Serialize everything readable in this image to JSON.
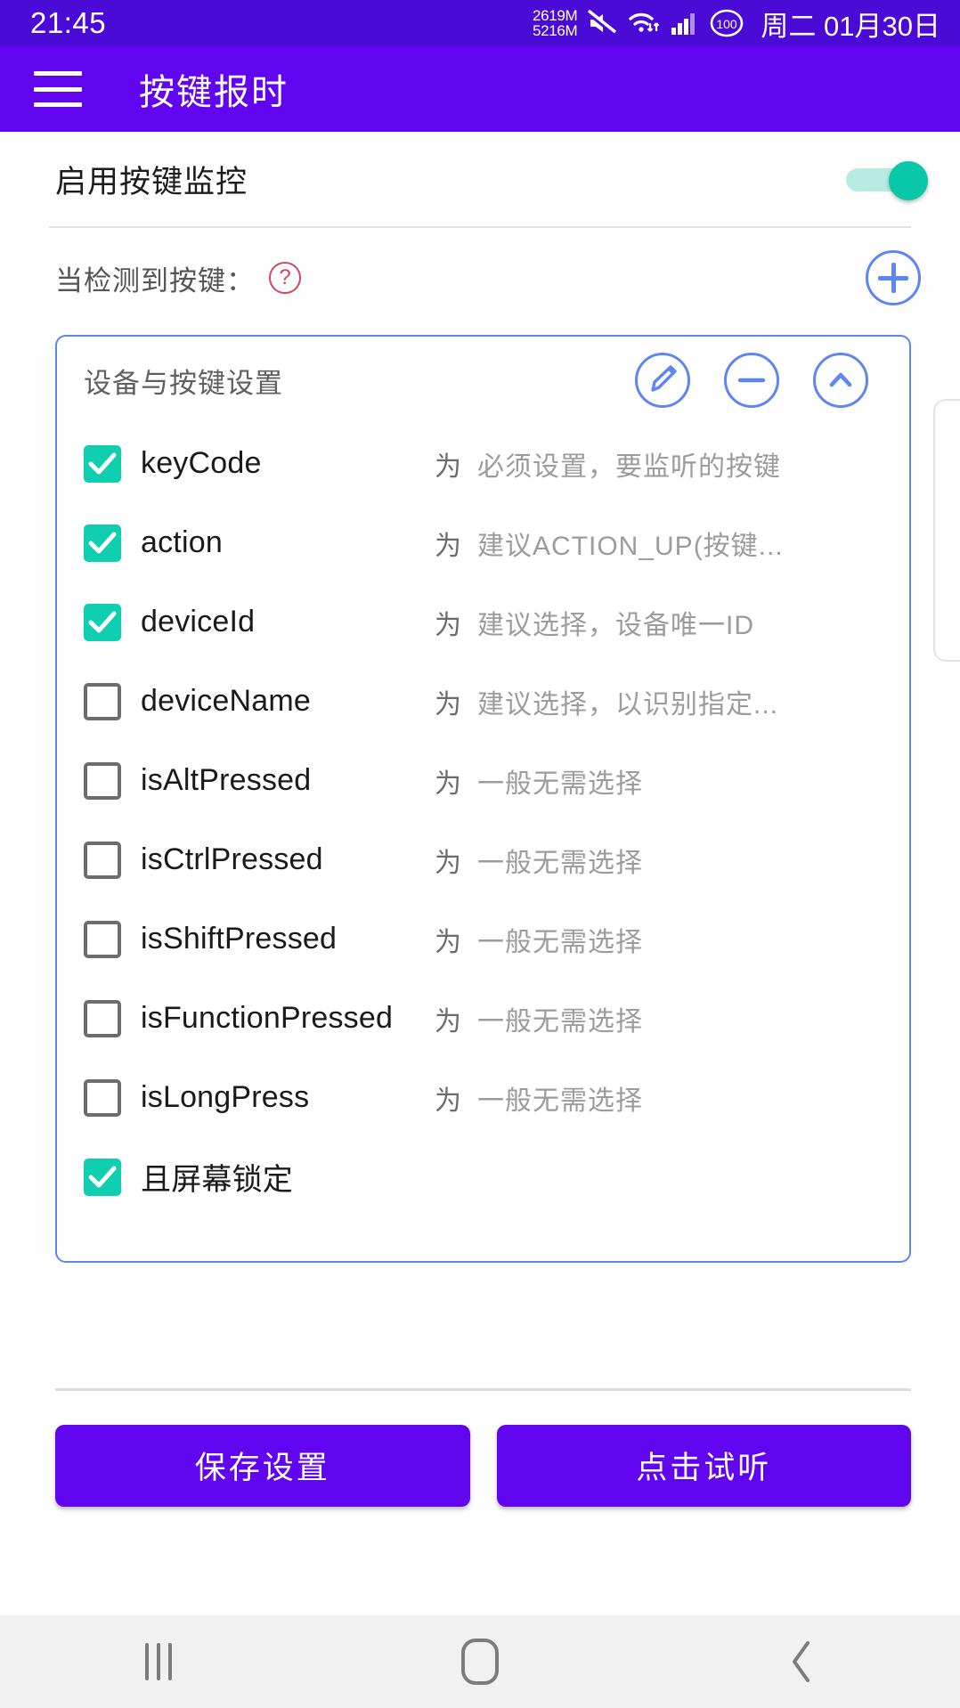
{
  "status_bar": {
    "time": "21:45",
    "memory_used": "2619M",
    "memory_total": "5216M",
    "battery_level": "100",
    "date": "周二 01月30日",
    "icons": [
      "mute-icon",
      "wifi-icon",
      "signal-icon",
      "battery-icon"
    ]
  },
  "app_bar": {
    "menu_icon": "hamburger-menu-icon",
    "title": "按键报时"
  },
  "monitor_row": {
    "label": "启用按键监控",
    "switch_on": true
  },
  "detect_row": {
    "label": "当检测到按键：",
    "help_icon": "question-mark-icon",
    "add_icon": "plus-circle-icon"
  },
  "card": {
    "title": "设备与按键设置",
    "actions": [
      {
        "name": "edit-button",
        "icon": "pencil-icon"
      },
      {
        "name": "remove-button",
        "icon": "minus-circle-icon"
      },
      {
        "name": "collapse-button",
        "icon": "chevron-up-icon"
      }
    ],
    "separator": "为",
    "items": [
      {
        "label": "keyCode",
        "checked": true,
        "sep": "为",
        "hint": "必须设置，要监听的按键"
      },
      {
        "label": "action",
        "checked": true,
        "sep": "为",
        "hint": "建议ACTION_UP(按键..."
      },
      {
        "label": "deviceId",
        "checked": true,
        "sep": "为",
        "hint": "建议选择，设备唯一ID"
      },
      {
        "label": "deviceName",
        "checked": false,
        "sep": "为",
        "hint": "建议选择，以识别指定..."
      },
      {
        "label": "isAltPressed",
        "checked": false,
        "sep": "为",
        "hint": "一般无需选择"
      },
      {
        "label": "isCtrlPressed",
        "checked": false,
        "sep": "为",
        "hint": "一般无需选择"
      },
      {
        "label": "isShiftPressed",
        "checked": false,
        "sep": "为",
        "hint": "一般无需选择"
      },
      {
        "label": "isFunctionPressed",
        "checked": false,
        "sep": "为",
        "hint": "一般无需选择"
      },
      {
        "label": "isLongPress",
        "checked": false,
        "sep": "为",
        "hint": "一般无需选择"
      },
      {
        "label": "且屏幕锁定",
        "checked": true,
        "sep": "",
        "hint": ""
      }
    ]
  },
  "actions": {
    "save_label": "保存设置",
    "preview_label": "点击试听"
  },
  "nav_bar": {
    "recents": "recents-icon",
    "home": "home-icon",
    "back": "back-icon"
  },
  "colors": {
    "status_bar": "#4B0BD6",
    "app_bar": "#6104F0",
    "accent_blue": "#5E86F2",
    "checkbox_teal": "#0FCFB0",
    "switch_teal": "#09C8AA",
    "help_red": "#D1485E",
    "button_purple": "#6104F0"
  }
}
